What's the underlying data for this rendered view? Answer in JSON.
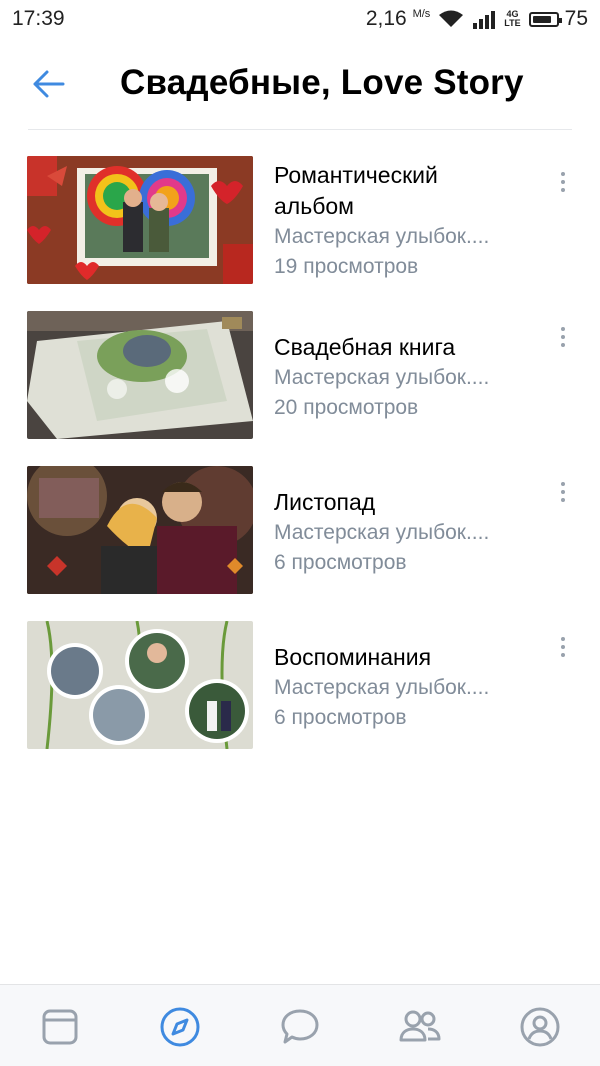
{
  "status_bar": {
    "time": "17:39",
    "speed_value": "2,16",
    "speed_unit": "M/s",
    "network_type_top": "4G",
    "network_type_bottom": "LTE",
    "battery_percent": "75"
  },
  "header": {
    "title": "Свадебные, Love Story",
    "back_icon": "arrow-left-icon"
  },
  "videos": [
    {
      "title_line1": "Романтический",
      "title_line2": "альбом",
      "author": "Мастерская улыбок....",
      "views": "19 просмотров"
    },
    {
      "title_line1": "Свадебная книга",
      "title_line2": "",
      "author": "Мастерская улыбок....",
      "views": "20 просмотров"
    },
    {
      "title_line1": "Листопад",
      "title_line2": "",
      "author": "Мастерская улыбок....",
      "views": "6 просмотров"
    },
    {
      "title_line1": "Воспоминания",
      "title_line2": "",
      "author": "Мастерская улыбок....",
      "views": "6 просмотров"
    }
  ],
  "tab_bar": {
    "tabs": [
      "news-icon",
      "discover-icon",
      "messages-icon",
      "friends-icon",
      "profile-icon"
    ],
    "active_tab": "discover-icon"
  },
  "colors": {
    "accent": "#3f8ae0",
    "secondary_text": "#818c99",
    "icon_gray": "#99a2ad"
  }
}
